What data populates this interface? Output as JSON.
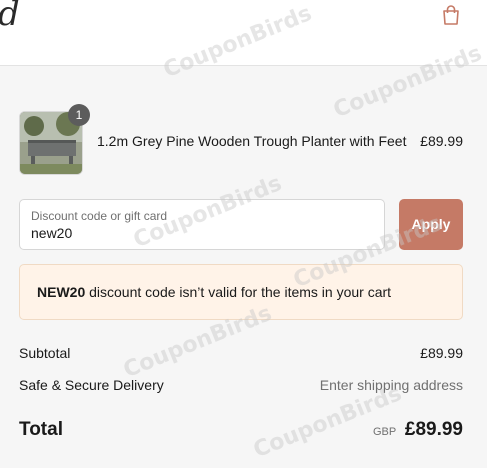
{
  "header": {
    "logo_fragment": "d",
    "cart_icon": "shopping-bag-icon"
  },
  "product": {
    "quantity": "1",
    "name": "1.2m Grey Pine Wooden Trough Planter with Feet",
    "price": "£89.99",
    "thumbnail_icon": "planter-thumbnail"
  },
  "discount": {
    "placeholder": "Discount code or gift card",
    "value": "new20",
    "apply_label": "Apply"
  },
  "error": {
    "code": "NEW20",
    "message": "discount code isn’t valid for the items in your cart"
  },
  "summary": {
    "subtotal_label": "Subtotal",
    "subtotal_value": "£89.99",
    "delivery_label": "Safe & Secure Delivery",
    "delivery_value": "Enter shipping address"
  },
  "total": {
    "label": "Total",
    "currency": "GBP",
    "amount": "£89.99"
  },
  "watermark": {
    "text": "CouponBirds"
  },
  "colors": {
    "apply_button": "#c57a66",
    "error_background": "#fff3e8",
    "page_background": "#f6f6f6"
  }
}
